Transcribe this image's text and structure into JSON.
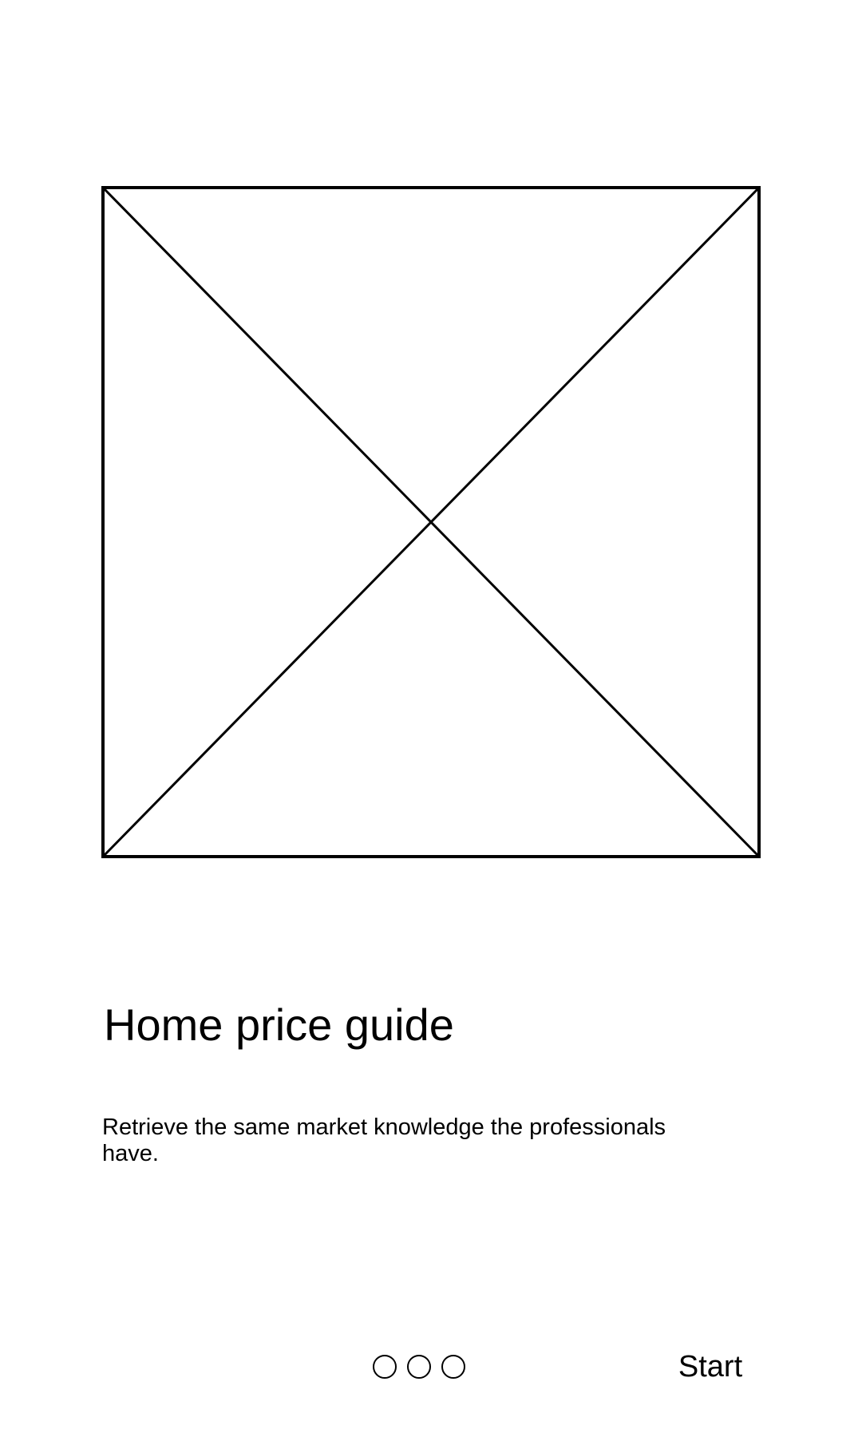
{
  "onboarding": {
    "image_icon": "image-placeholder-icon",
    "title": "Home price guide",
    "description": "Retrieve the same market knowledge the professionals have."
  },
  "pager": {
    "page_count": 3
  },
  "actions": {
    "start_label": "Start"
  },
  "colors": {
    "background": "#ffffff",
    "foreground": "#000000"
  }
}
